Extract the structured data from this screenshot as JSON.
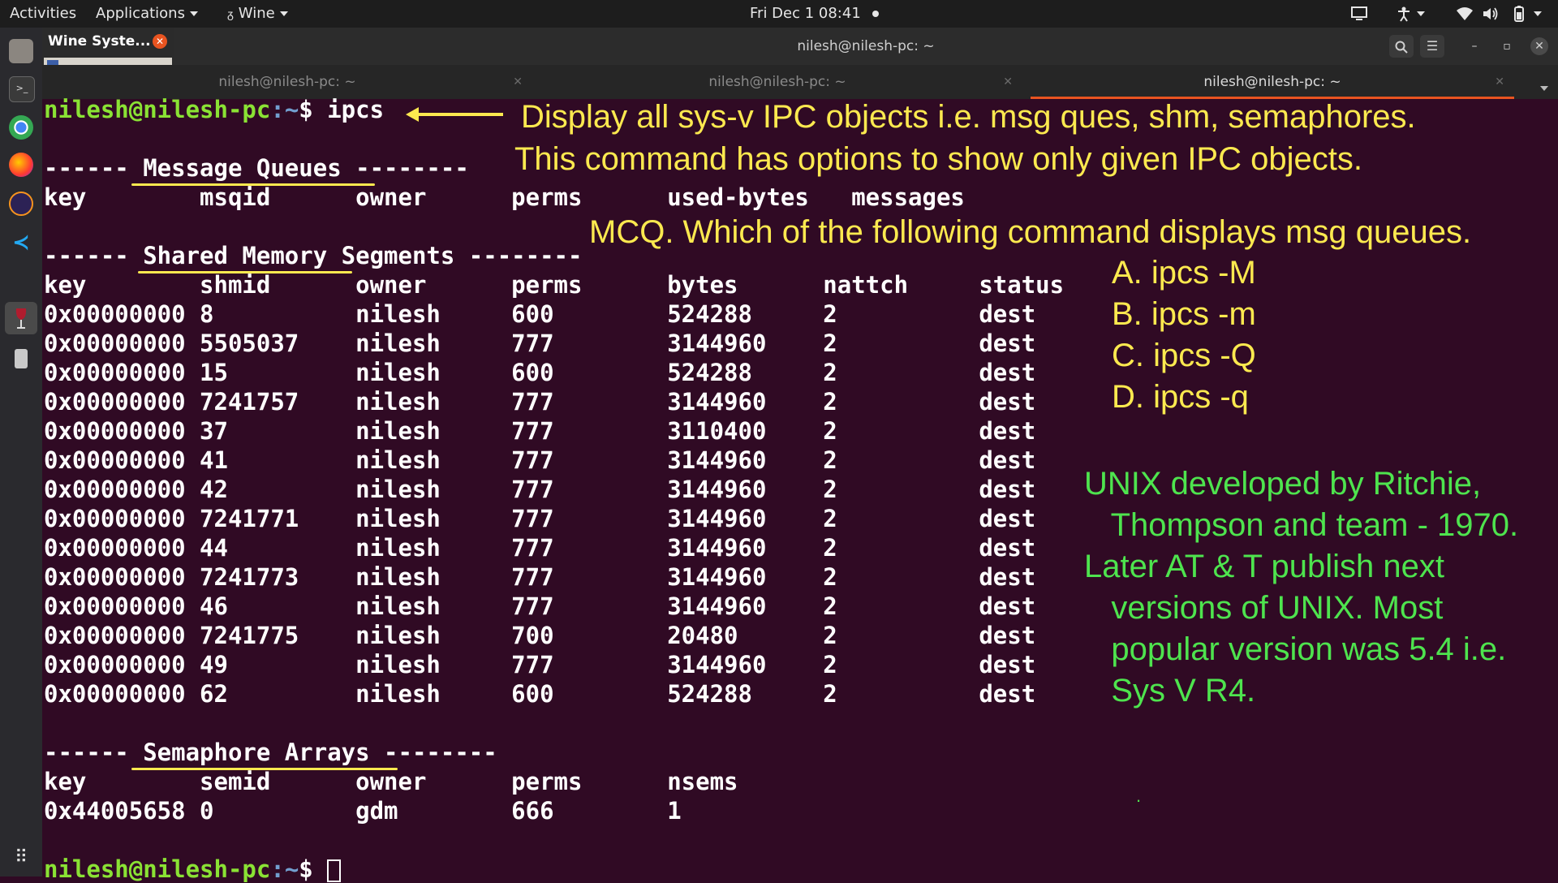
{
  "topbar": {
    "activities": "Activities",
    "applications": "Applications",
    "wine": "Wine",
    "datetime": "Fri Dec 1  08:41"
  },
  "wine_popup": {
    "title": "Wine Syste..."
  },
  "window": {
    "title": "nilesh@nilesh-pc: ~"
  },
  "tabs": [
    {
      "label": "nilesh@nilesh-pc: ~",
      "active": false
    },
    {
      "label": "nilesh@nilesh-pc: ~",
      "active": false
    },
    {
      "label": "nilesh@nilesh-pc: ~",
      "active": true
    }
  ],
  "terminal": {
    "prompt_user": "nilesh@nilesh-pc",
    "prompt_path": ":~",
    "prompt_dollar": "$ ",
    "command": "ipcs",
    "mq_header": "------ Message Queues --------",
    "mq_columns": "key        msqid      owner      perms      used-bytes   messages",
    "shm_header": "------ Shared Memory Segments --------",
    "shm_columns": "key        shmid      owner      perms      bytes      nattch     status",
    "shm_rows": [
      "0x00000000 8          nilesh     600        524288     2          dest",
      "0x00000000 5505037    nilesh     777        3144960    2          dest",
      "0x00000000 15         nilesh     600        524288     2          dest",
      "0x00000000 7241757    nilesh     777        3144960    2          dest",
      "0x00000000 37         nilesh     777        3110400    2          dest",
      "0x00000000 41         nilesh     777        3144960    2          dest",
      "0x00000000 42         nilesh     777        3144960    2          dest",
      "0x00000000 7241771    nilesh     777        3144960    2          dest",
      "0x00000000 44         nilesh     777        3144960    2          dest",
      "0x00000000 7241773    nilesh     777        3144960    2          dest",
      "0x00000000 46         nilesh     777        3144960    2          dest",
      "0x00000000 7241775    nilesh     700        20480      2          dest",
      "0x00000000 49         nilesh     777        3144960    2          dest",
      "0x00000000 62         nilesh     600        524288     2          dest"
    ],
    "sem_header": "------ Semaphore Arrays --------",
    "sem_columns": "key        semid      owner      perms      nsems",
    "sem_row": "0x44005658 0          gdm        666        1"
  },
  "annotations": {
    "line1": "Display all sys-v IPC objects i.e. msg ques, shm, semaphores.",
    "line2": "This command has options to show only given IPC objects.",
    "mcq": "MCQ. Which of the following command displays msg queues.",
    "options": [
      "A. ipcs -M",
      "B. ipcs -m",
      "C. ipcs -Q",
      "D. ipcs -q"
    ],
    "history": [
      "UNIX developed by Ritchie,",
      "   Thompson and team - 1970.",
      "Later AT & T publish next",
      "   versions of UNIX. Most",
      "   popular version was 5.4 i.e.",
      "   Sys V R4."
    ],
    "dot": "."
  },
  "colors": {
    "terminal_bg": "#300a24",
    "prompt_user": "#8ae234",
    "prompt_path": "#729fcf",
    "annotation_yellow": "#fce94f",
    "annotation_green": "#4ee44e",
    "tab_accent": "#e95420"
  },
  "icons": [
    "files-icon",
    "terminal-icon",
    "chrome-icon",
    "firefox-icon",
    "eclipse-icon",
    "vscode-icon",
    "wine-icon",
    "drive-icon",
    "app-grid-icon",
    "display-icon",
    "accessibility-icon",
    "wifi-icon",
    "volume-icon",
    "battery-icon",
    "search-icon",
    "hamburger-menu-icon",
    "minimize-icon",
    "maximize-icon",
    "close-icon",
    "arrow-left-icon"
  ]
}
